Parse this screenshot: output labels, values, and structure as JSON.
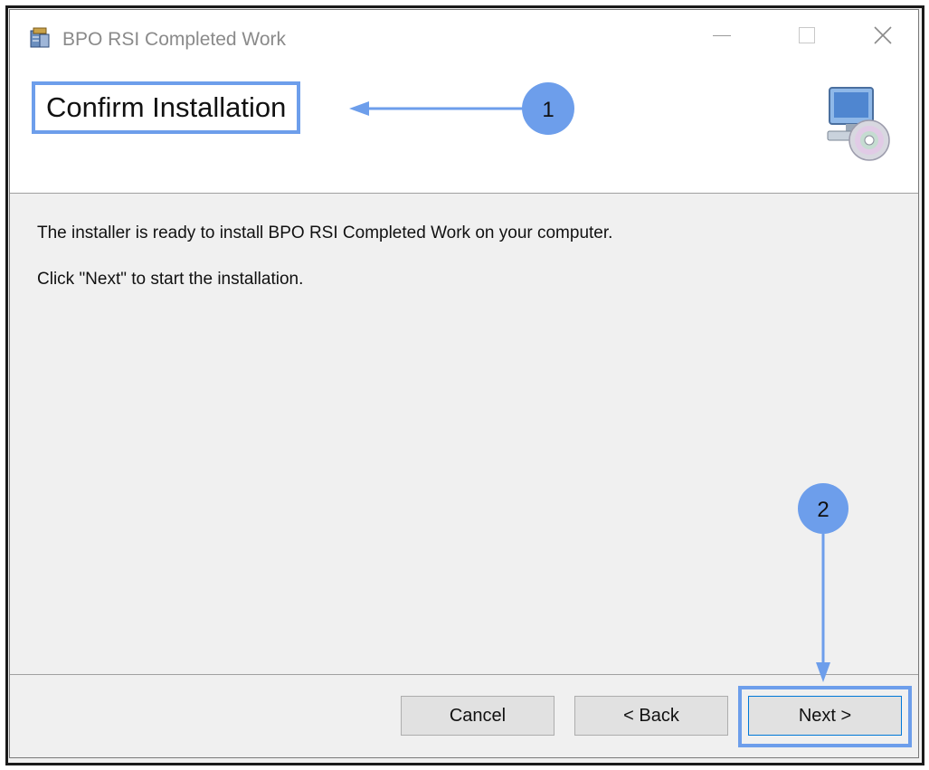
{
  "window": {
    "title": "BPO RSI Completed Work",
    "controls": {
      "minimize": "—",
      "maximize": "☐",
      "close": "✕"
    }
  },
  "header": {
    "title": "Confirm Installation",
    "icon": "computer-disc-icon"
  },
  "content": {
    "line1": "The installer is ready to install BPO RSI Completed Work on your computer.",
    "line2": "Click \"Next\" to start the installation."
  },
  "buttons": {
    "cancel": "Cancel",
    "back": "< Back",
    "next": "Next >"
  },
  "annotations": {
    "badge1": "1",
    "badge2": "2",
    "accent_color": "#6d9eeb"
  }
}
